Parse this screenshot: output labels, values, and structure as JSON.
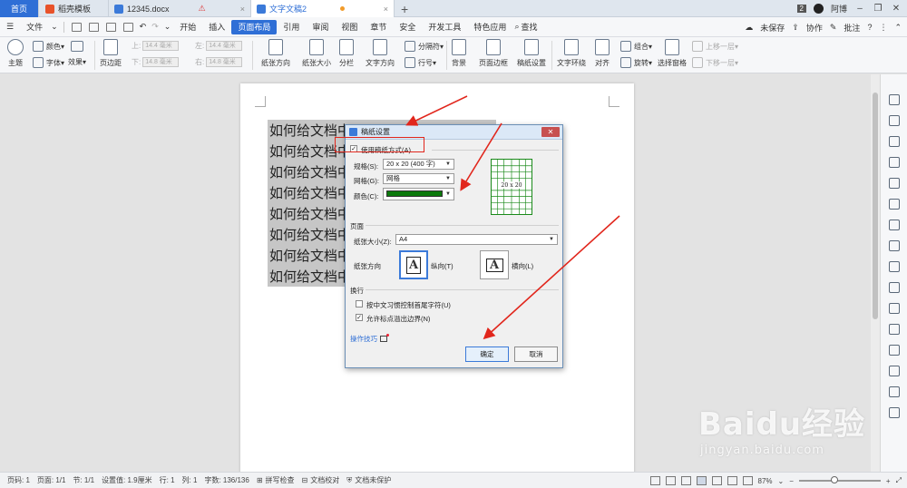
{
  "tabs": {
    "home": "首页",
    "tab1": "稻壳模板",
    "tab2": "12345.docx",
    "tab3": "文字文稿2",
    "badge": "2",
    "user": "阿博"
  },
  "menu": {
    "file": "文件",
    "items": [
      "开始",
      "插入",
      "页面布局",
      "引用",
      "审阅",
      "视图",
      "章节",
      "安全",
      "开发工具",
      "特色应用"
    ],
    "search": "查找",
    "unsaved": "未保存",
    "collab": "协作",
    "comment": "批注"
  },
  "ribbon": {
    "theme": "主题",
    "color": "颜色",
    "font": "字体",
    "effect": "效果",
    "margin": "页边距",
    "up_label": "上:",
    "down_label": "下:",
    "left_label": "左:",
    "right_label": "右:",
    "mm_value": "14.4 毫米",
    "mm_value2": "14.8 毫米",
    "orientation": "纸张方向",
    "size": "纸张大小",
    "columns": "分栏",
    "text_direction": "文字方向",
    "line_number": "行号",
    "separator": "分隔符",
    "background": "背景",
    "page_border": "页面边框",
    "manuscript": "稿纸设置",
    "wrap": "文字环绕",
    "align": "对齐",
    "rotate": "旋转",
    "combine": "组合",
    "select_pane": "选择窗格",
    "move_up": "上移一层",
    "move_down": "下移一层"
  },
  "document": {
    "lines": [
      "如何给文档中",
      "如何给文档中",
      "如何给文档中",
      "如何给文档中",
      "如何给文档中",
      "如何给文档中",
      "如何给文档中",
      "如何给文档中"
    ]
  },
  "dialog": {
    "title": "稿纸设置",
    "use_manuscript": "使用稿纸方式(A)",
    "spec_label": "规格(S):",
    "spec_value": "20 x 20 (400 字)",
    "grid_label": "网格(G):",
    "grid_value": "网格",
    "color_label": "颜色(C):",
    "preview_text": "20 x 20",
    "page_group": "页面",
    "paper_size_label": "纸张大小(Z):",
    "paper_size_value": "A4",
    "orientation_label": "纸张方向",
    "portrait": "纵向(T)",
    "landscape": "横向(L)",
    "portrait_glyph": "A",
    "landscape_glyph": "A",
    "wrap_group": "换行",
    "opt1": "按中文习惯控制首尾字符(U)",
    "opt2": "允许标点溢出边界(N)",
    "tips": "操作技巧",
    "ok": "确定",
    "cancel": "取消",
    "color_value": "#0c7a0c"
  },
  "status": {
    "page": "页码: 1",
    "pages": "页面: 1/1",
    "section": "节: 1/1",
    "setting": "设置值: 1.9厘米",
    "row": "行: 1",
    "col": "列: 1",
    "words": "字数: 136/136",
    "spell": "拼写检查",
    "proof": "文档校对",
    "protect": "文档未保护",
    "zoom": "87%"
  },
  "watermark": {
    "brand": "Baidu经验",
    "url": "jingyan.baidu.com"
  }
}
